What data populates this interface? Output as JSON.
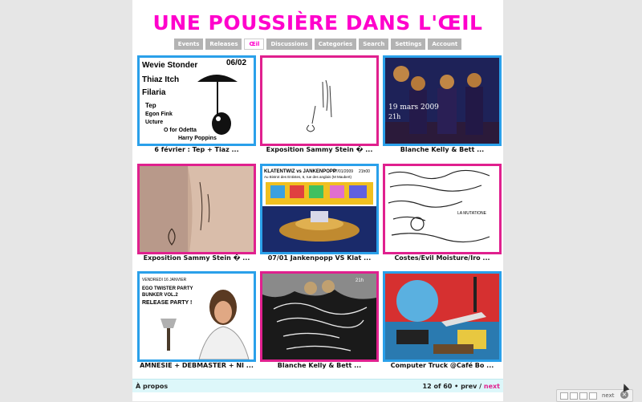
{
  "site": {
    "title": "UNE POUSSIÈRE DANS L'ŒIL",
    "accent_color": "#ff00cc"
  },
  "nav": {
    "tabs": [
      {
        "label": "Events"
      },
      {
        "label": "Releases"
      },
      {
        "label": "Œil",
        "active": true
      },
      {
        "label": "Discussions"
      },
      {
        "label": "Categories"
      },
      {
        "label": "Search"
      },
      {
        "label": "Settings"
      },
      {
        "label": "Account"
      }
    ]
  },
  "grid": {
    "items": [
      {
        "caption": "6 février : Tep + Tiaz ...",
        "frame": "blue",
        "poster": {
          "date": "06/02",
          "names": [
            "Wevie Stonder",
            "Thiaz Itch",
            "Filaria",
            "Tep",
            "Egon Fink",
            "Ucture",
            "O for Odetta",
            "Harry Poppins"
          ]
        }
      },
      {
        "caption": "Exposition Sammy Stein � ...",
        "frame": "pink"
      },
      {
        "caption": "Blanche Kelly & Bett ...",
        "frame": "blue",
        "poster": {
          "date": "19 mars 2009",
          "hours": "21h"
        }
      },
      {
        "caption": "Exposition Sammy Stein � ...",
        "frame": "pink"
      },
      {
        "caption": "07/01 Jankenpopp VS Klat ...",
        "frame": "blue",
        "poster": {
          "headline": "KLATENTWIZ vs JANKENPOPP",
          "date": "07/01/2009",
          "hours": "21h00",
          "address": "Au Bistrot des Entistes, 6, rue des anglais (M Maubert)"
        }
      },
      {
        "caption": "Costes/Evil Moisture/Iro ...",
        "frame": "pink",
        "poster": {
          "text": "LA MUTATIONE"
        }
      },
      {
        "caption": "AMNESIE + DEBMASTER + NI ...",
        "frame": "blue",
        "poster": {
          "date": "VENDREDI 16 JANVIER",
          "lines": [
            "EGO TWISTER PARTY",
            "BUNKER VOL.2",
            "RELEASE PARTY !"
          ]
        }
      },
      {
        "caption": "Blanche Kelly & Bett ...",
        "frame": "pink",
        "poster": {
          "hours": "21h"
        }
      },
      {
        "caption": "Computer Truck @Café Bo ...",
        "frame": "blue"
      }
    ]
  },
  "footer": {
    "about_label": "À propos",
    "page_info": "12 of 60 •",
    "prev_label": "prev",
    "separator": "/",
    "next_label": "next"
  },
  "findbar": {
    "label": "next"
  }
}
